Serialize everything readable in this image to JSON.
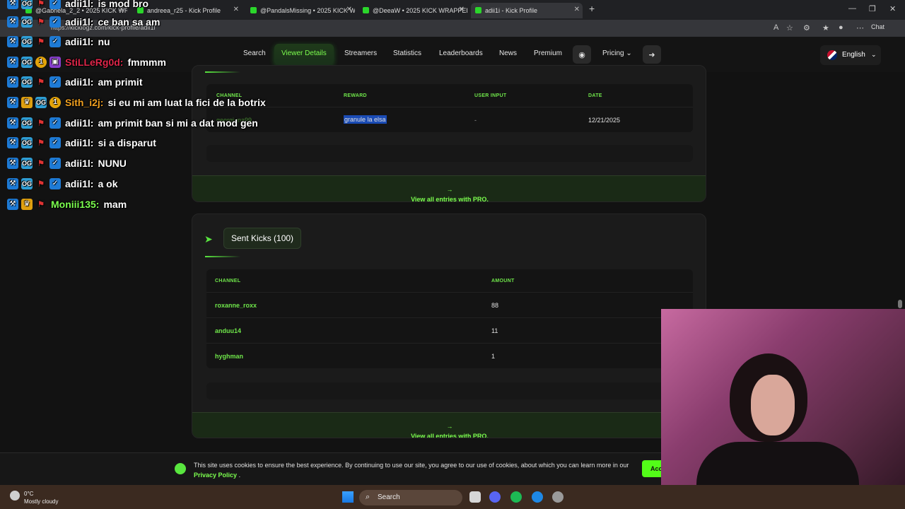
{
  "browser": {
    "tabs": [
      {
        "label": "@Gabriela_2_2 • 2025 KICK WRAP"
      },
      {
        "label": "andreea_r25 - Kick Profile"
      },
      {
        "label": "@PandalsMissing • 2025 KICK WR"
      },
      {
        "label": "@DeeaW • 2025 KICK WRAPPED |"
      },
      {
        "label": "adii1i - Kick Profile"
      }
    ],
    "url": "https://kicklogz.com/kick-profile/adii1i",
    "chat_label": "Chat"
  },
  "nav": {
    "items": [
      "Search",
      "Viewer Details",
      "Streamers",
      "Statistics",
      "Leaderboards",
      "News",
      "Premium",
      "Pricing"
    ],
    "active": "Viewer Details",
    "language": "English"
  },
  "redemptions": {
    "headers": [
      "CHANNEL",
      "REWARD",
      "USER INPUT",
      "DATE"
    ],
    "rows": [
      {
        "channel": "georgiana99",
        "reward": "granule la elsa",
        "input": "-",
        "date": "12/21/2025"
      }
    ],
    "footer": "View all entries with PRO."
  },
  "sent_kicks": {
    "title": "Sent Kicks (100)",
    "headers": [
      "CHANNEL",
      "AMOUNT"
    ],
    "rows": [
      {
        "channel": "roxanne_roxx",
        "amount": "88"
      },
      {
        "channel": "anduu14",
        "amount": "11"
      },
      {
        "channel": "hyghman",
        "amount": "1"
      }
    ],
    "footer": "View all entries with PRO."
  },
  "cookie": {
    "text": "This site uses cookies to ensure the best experience. By continuing to use our site, you agree to our use of cookies, about which you can learn more in our",
    "link": "Privacy Policy",
    "end": ".",
    "accept": "Acc"
  },
  "chat": [
    {
      "user": "adii1l:",
      "msg": "is mod bro",
      "color": "#ffffff"
    },
    {
      "user": "adii1l:",
      "msg": "ce ban sa am",
      "color": "#ffffff"
    },
    {
      "user": "adii1l:",
      "msg": "nu",
      "color": "#ffffff"
    },
    {
      "user": "StiLLeRg0d:",
      "msg": "fmmmm",
      "color": "#e0264a"
    },
    {
      "user": "adii1l:",
      "msg": "am primit",
      "color": "#ffffff"
    },
    {
      "user": "Sith_i2j:",
      "msg": "si eu mi am luat la fici de la botrix",
      "color": "#f0a020"
    },
    {
      "user": "adii1l:",
      "msg": "am primit ban si mi a dat mod gen",
      "color": "#ffffff"
    },
    {
      "user": "adii1l:",
      "msg": "si a disparut",
      "color": "#ffffff"
    },
    {
      "user": "adii1l:",
      "msg": "NUNU",
      "color": "#ffffff"
    },
    {
      "user": "adii1l:",
      "msg": "a ok",
      "color": "#ffffff"
    },
    {
      "user": "Moniii135:",
      "msg": "mam",
      "color": "#7cff4f"
    }
  ],
  "taskbar": {
    "temp": "0°C",
    "weather": "Mostly cloudy",
    "search": "Search"
  }
}
